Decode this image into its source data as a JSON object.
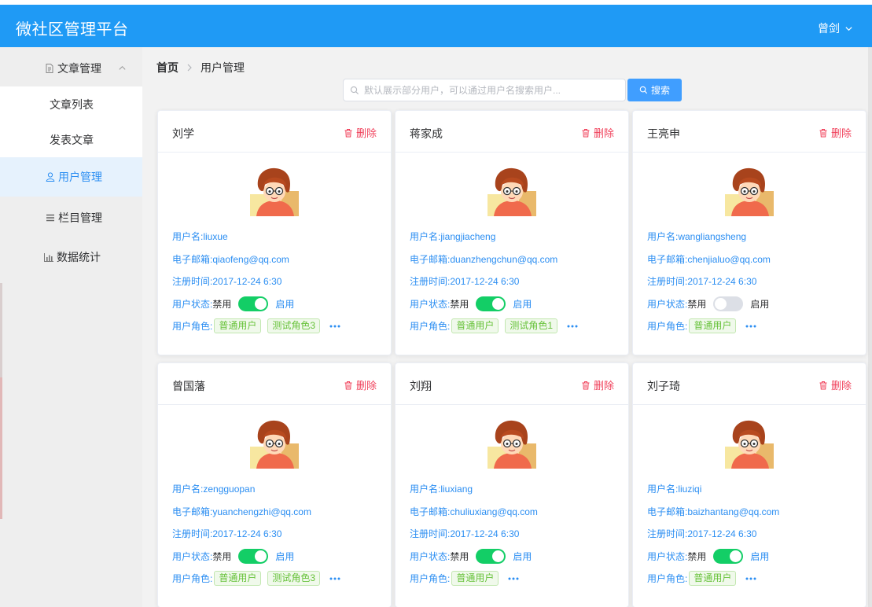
{
  "app": {
    "title": "微社区管理平台",
    "user": "曾剑",
    "accent": "#1f9af5"
  },
  "sidebar": {
    "items": [
      {
        "label": "文章管理",
        "icon": "document-icon"
      },
      {
        "label": "文章列表"
      },
      {
        "label": "发表文章"
      },
      {
        "label": "用户管理",
        "icon": "user-icon",
        "active": true
      },
      {
        "label": "栏目管理",
        "icon": "menu-lines-icon"
      },
      {
        "label": "数据统计",
        "icon": "bar-chart-icon"
      }
    ]
  },
  "breadcrumb": {
    "home": "首页",
    "current": "用户管理"
  },
  "search": {
    "placeholder": "默认展示部分用户，可以通过用户名搜索用户...",
    "button": "搜索"
  },
  "labels": {
    "delete": "删除",
    "username": "用户名:",
    "email": "电子邮箱:",
    "registered": "注册时间:",
    "status": "用户状态:",
    "disabled": "禁用",
    "enabled": "启用",
    "roles": "用户角色:"
  },
  "users": [
    {
      "name": "刘学",
      "username": "liuxue",
      "email": "qiaofeng@qq.com",
      "registered": "2017-12-24 6:30",
      "enabled": true,
      "roles": [
        "普通用户",
        "测试角色3"
      ]
    },
    {
      "name": "蒋家成",
      "username": "jiangjiacheng",
      "email": "duanzhengchun@qq.com",
      "registered": "2017-12-24 6:30",
      "enabled": true,
      "roles": [
        "普通用户",
        "测试角色1"
      ]
    },
    {
      "name": "王亮申",
      "username": "wangliangsheng",
      "email": "chenjialuo@qq.com",
      "registered": "2017-12-24 6:30",
      "enabled": false,
      "roles": [
        "普通用户"
      ]
    },
    {
      "name": "曾国藩",
      "username": "zengguopan",
      "email": "yuanchengzhi@qq.com",
      "registered": "2017-12-24 6:30",
      "enabled": true,
      "roles": [
        "普通用户",
        "测试角色3"
      ]
    },
    {
      "name": "刘翔",
      "username": "liuxiang",
      "email": "chuliuxiang@qq.com",
      "registered": "2017-12-24 6:30",
      "enabled": true,
      "roles": [
        "普通用户"
      ]
    },
    {
      "name": "刘子琦",
      "username": "liuziqi",
      "email": "baizhantang@qq.com",
      "registered": "2017-12-24 6:30",
      "enabled": true,
      "roles": [
        "普通用户"
      ]
    }
  ]
}
